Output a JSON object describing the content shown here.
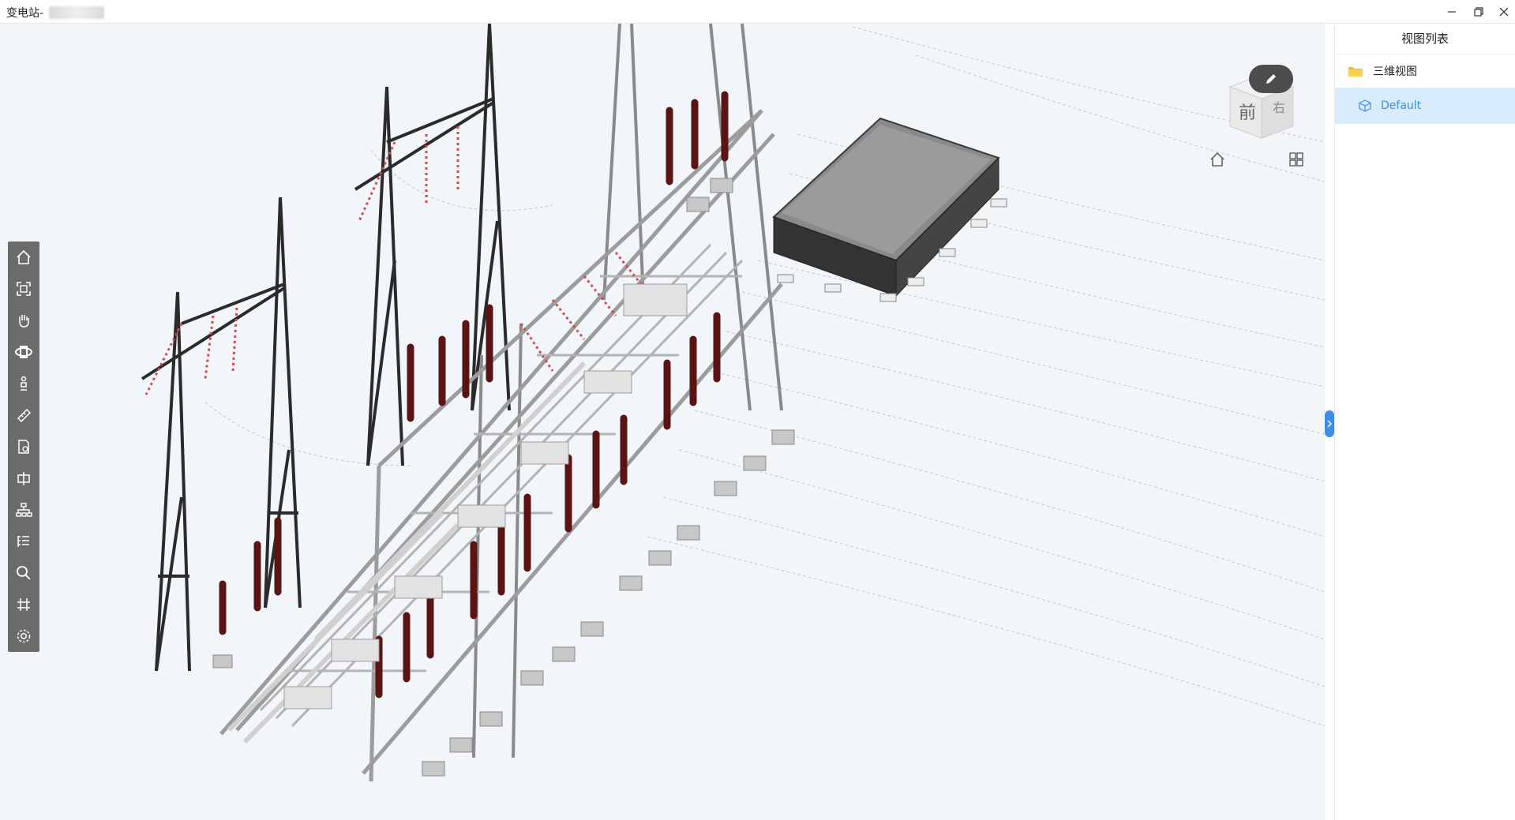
{
  "window": {
    "title": "变电站-",
    "minimize_icon": "minimize-icon",
    "restore_icon": "restore-icon",
    "close_icon": "close-icon"
  },
  "toolbar": {
    "tools": [
      {
        "icon": "home-icon"
      },
      {
        "icon": "fit-view-icon"
      },
      {
        "icon": "pan-hand-icon"
      },
      {
        "icon": "orbit-icon"
      },
      {
        "icon": "walk-person-icon"
      },
      {
        "icon": "measure-ruler-icon"
      },
      {
        "icon": "properties-icon"
      },
      {
        "icon": "section-box-icon"
      },
      {
        "icon": "model-tree-icon"
      },
      {
        "icon": "list-icon"
      },
      {
        "icon": "search-icon"
      },
      {
        "icon": "grid-axis-icon"
      },
      {
        "icon": "settings-gear-icon"
      }
    ]
  },
  "navcube": {
    "front_label": "前",
    "right_label": "右"
  },
  "panel": {
    "title": "视图列表",
    "folder_label": "三维视图",
    "item_label": "Default"
  },
  "colors": {
    "accent": "#3b8eea",
    "selected_bg": "#d9ecfb",
    "viewport_bg": "#f2f5fa",
    "toolbar_bg": "#6b6b6b"
  }
}
